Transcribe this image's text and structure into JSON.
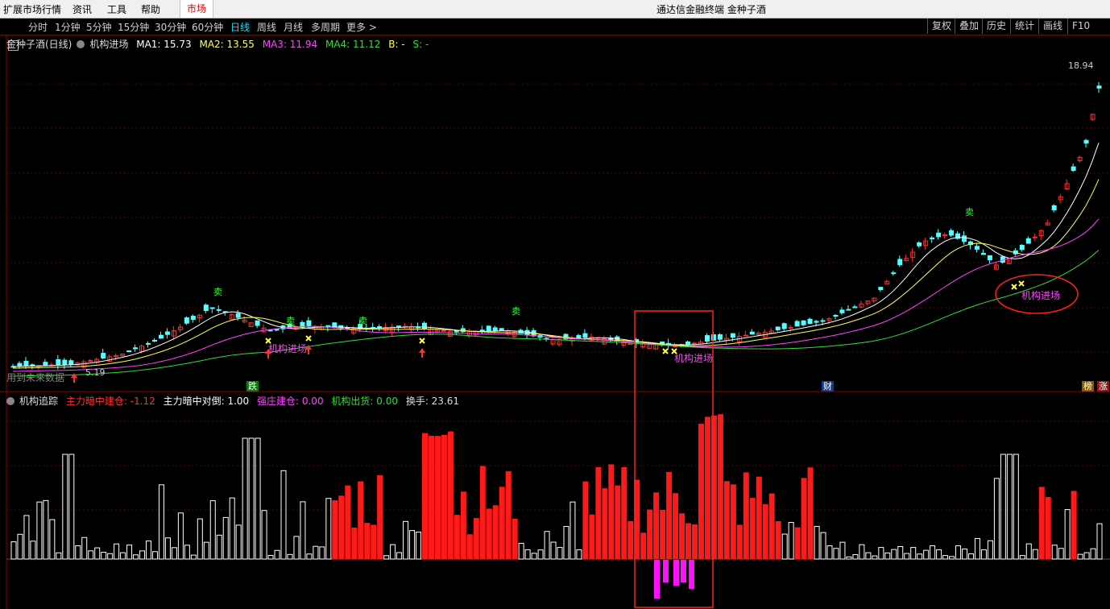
{
  "menu": {
    "items": [
      "扩展市场行情",
      "资讯",
      "工具",
      "帮助"
    ],
    "market_tab": "市场",
    "app_title": "通达信金融终端 金种子酒"
  },
  "periods": [
    "分时",
    "1分钟",
    "5分钟",
    "15分钟",
    "30分钟",
    "60分钟",
    "日线",
    "周线",
    "月线",
    "多周期",
    "更多 >"
  ],
  "active_period": "日线",
  "right_buttons": [
    "复权",
    "叠加",
    "历史",
    "统计",
    "画线",
    "F10"
  ],
  "main_chart": {
    "stock_label": "金种子酒(日线)",
    "indicator_name": "机构进场",
    "ma": [
      {
        "label": "MA1: 15.73",
        "color": "#ffffff"
      },
      {
        "label": "MA2: 13.55",
        "color": "#ffff55"
      },
      {
        "label": "MA3: 11.94",
        "color": "#ff44ff"
      },
      {
        "label": "MA4: 11.12",
        "color": "#33dd33"
      },
      {
        "label": "B: -",
        "color": "#ffff55"
      },
      {
        "label": "S: -",
        "color": "#33dd33"
      }
    ],
    "max_price": "18.94",
    "min_price": "5.19",
    "future_label": "用到未来数据",
    "signal_label": "机构进场",
    "sell_label": "卖",
    "tags": {
      "die": "跌",
      "cai": "财",
      "bang": "榜",
      "zhang": "涨"
    }
  },
  "sub_chart": {
    "name": "机构追踪",
    "fields": [
      {
        "label": "主力暗中建仓: -1.12",
        "color": "#ff3030"
      },
      {
        "label": "主力暗中对倒: 1.00",
        "color": "#ffffff"
      },
      {
        "label": "强庄建仓: 0.00",
        "color": "#ff44ff"
      },
      {
        "label": "机构出货: 0.00",
        "color": "#33dd33"
      },
      {
        "label": "换手: 23.61",
        "color": "#dddddd"
      }
    ]
  },
  "colors": {
    "up": "#ff3030",
    "down": "#54ffff",
    "grid": "#7a0000",
    "highlight_box": "#ff2020"
  }
}
